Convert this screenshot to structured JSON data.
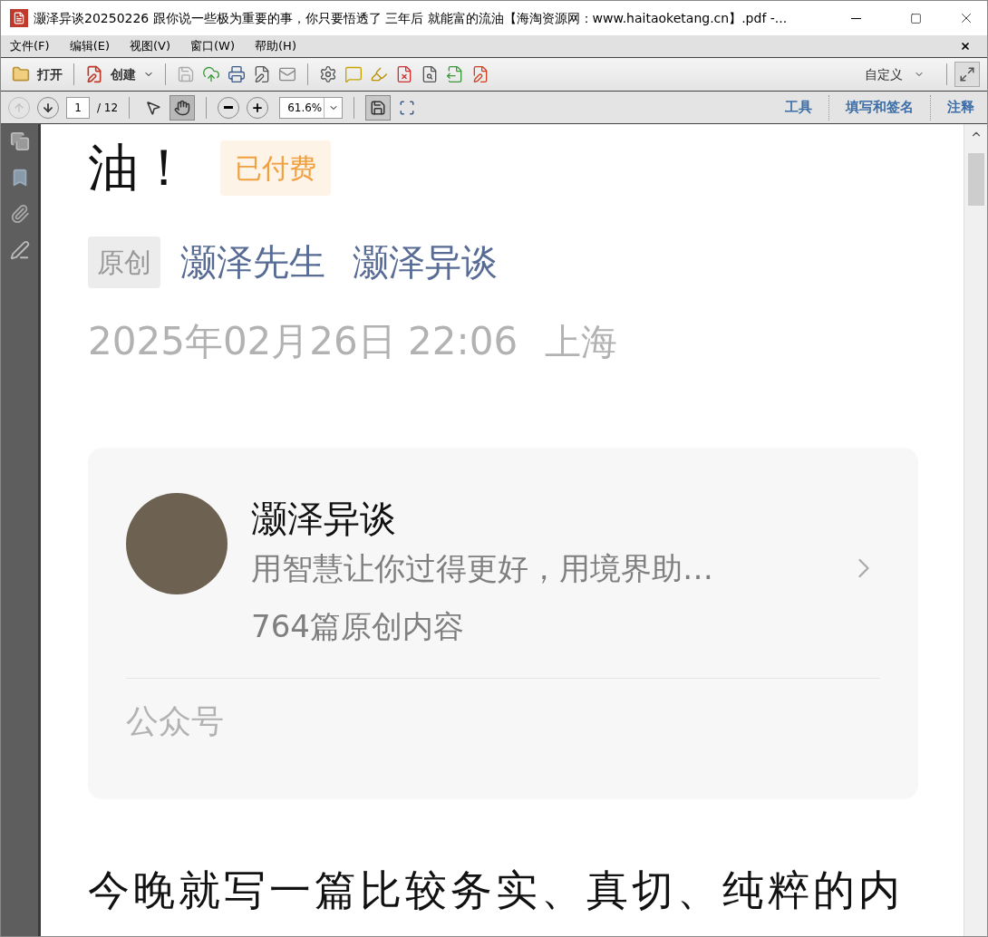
{
  "window": {
    "title": "灏泽异谈20250226 跟你说一些极为重要的事，你只要悟透了 三年后 就能富的流油【海淘资源网：www.haitaoketang.cn】.pdf -..."
  },
  "menu": [
    "文件(F)",
    "编辑(E)",
    "视图(V)",
    "窗口(W)",
    "帮助(H)"
  ],
  "toolbar": {
    "open": "打开",
    "create": "创建",
    "customize": "自定义"
  },
  "nav": {
    "page": "1",
    "total": "/ 12",
    "zoom": "61.6%",
    "hand_selected": true
  },
  "panes": [
    {
      "label": "工具"
    },
    {
      "label": "填写和签名"
    },
    {
      "label": "注释"
    }
  ],
  "document": {
    "title_tail": "油！",
    "paid_badge": "已付费",
    "original_tag": "原创",
    "author": "灏泽先生",
    "account": "灏泽异谈",
    "date": "2025年02月26日 22:06",
    "location": "上海",
    "card": {
      "name": "灏泽异谈",
      "description": "用智慧让你过得更好，用境界助…",
      "count": "764篇原创内容",
      "type": "公众号"
    },
    "body": "今晚就写一篇比较务实、真切、纯粹的内"
  }
}
